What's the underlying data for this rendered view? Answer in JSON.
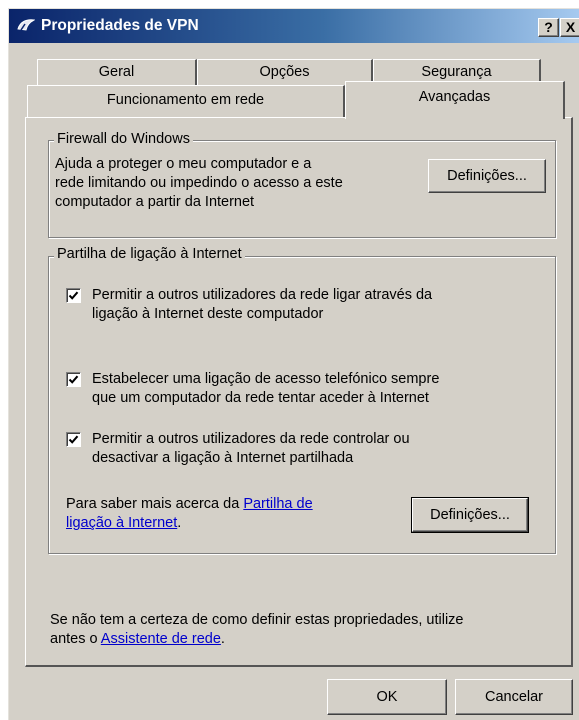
{
  "window": {
    "title": "Propriedades de VPN",
    "help_label": "?",
    "close_label": "X"
  },
  "tabs": {
    "row1": [
      "Geral",
      "Opções",
      "Segurança"
    ],
    "row2": [
      "Funcionamento em rede",
      "Avançadas"
    ],
    "active": "Avançadas"
  },
  "firewall": {
    "title": "Firewall do Windows",
    "line1": "Ajuda a proteger o meu computador e a",
    "line2": "rede limitando ou impedindo o acesso a este",
    "line3": "computador a partir da Internet",
    "button": "Definições..."
  },
  "ics": {
    "title": "Partilha de ligação à Internet",
    "options": [
      {
        "checked": true,
        "line1": "Permitir a outros utilizadores da rede ligar através da",
        "line2": "ligação à Internet deste computador"
      },
      {
        "checked": true,
        "line1": "Estabelecer uma ligação de acesso telefónico sempre",
        "line2": "que um computador da rede tentar aceder à Internet"
      },
      {
        "checked": true,
        "line1": "Permitir a outros utilizadores da rede controlar ou",
        "line2": "desactivar a ligação à Internet partilhada"
      }
    ],
    "more_prefix": "Para saber mais acerca da ",
    "more_link_1": "Partilha de",
    "more_link_2": "ligação à Internet",
    "more_suffix": ".",
    "button": "Definições..."
  },
  "footer": {
    "line1": "Se não tem a certeza de como definir estas propriedades, utilize",
    "line2_prefix": "antes o ",
    "line2_link": "Assistente de rede",
    "line2_suffix": "."
  },
  "buttons": {
    "ok": "OK",
    "cancel": "Cancelar"
  }
}
